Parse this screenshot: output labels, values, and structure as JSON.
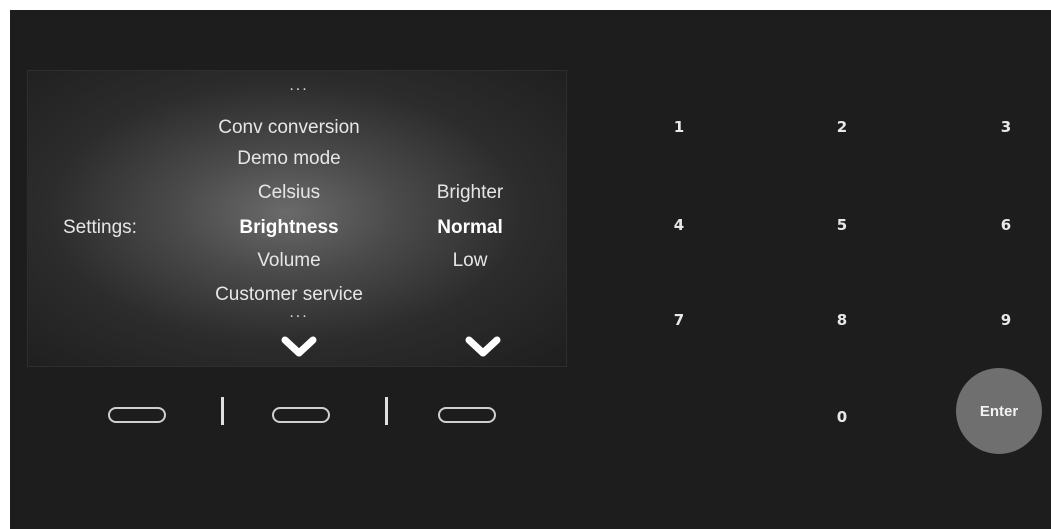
{
  "display": {
    "dots_top": "...",
    "dots_bottom": "...",
    "settings_label": "Settings:",
    "menu_items": [
      "Conv conversion",
      "Demo mode",
      "Celsius",
      "Brightness",
      "Volume",
      "Customer service"
    ],
    "selected_menu_item": "Brightness",
    "options": [
      "Brighter",
      "Normal",
      "Low"
    ],
    "selected_option": "Normal"
  },
  "keypad": {
    "keys": [
      "1",
      "2",
      "3",
      "4",
      "5",
      "6",
      "7",
      "8",
      "9",
      "0"
    ],
    "enter_label": "Enter"
  },
  "icons": {
    "scroll_down_menu": "chevron-down-icon",
    "scroll_down_options": "chevron-down-icon"
  },
  "colors": {
    "panel": "#1d1d1d",
    "enter_button": "#6f6f6f",
    "text": "#e6e6e6"
  }
}
